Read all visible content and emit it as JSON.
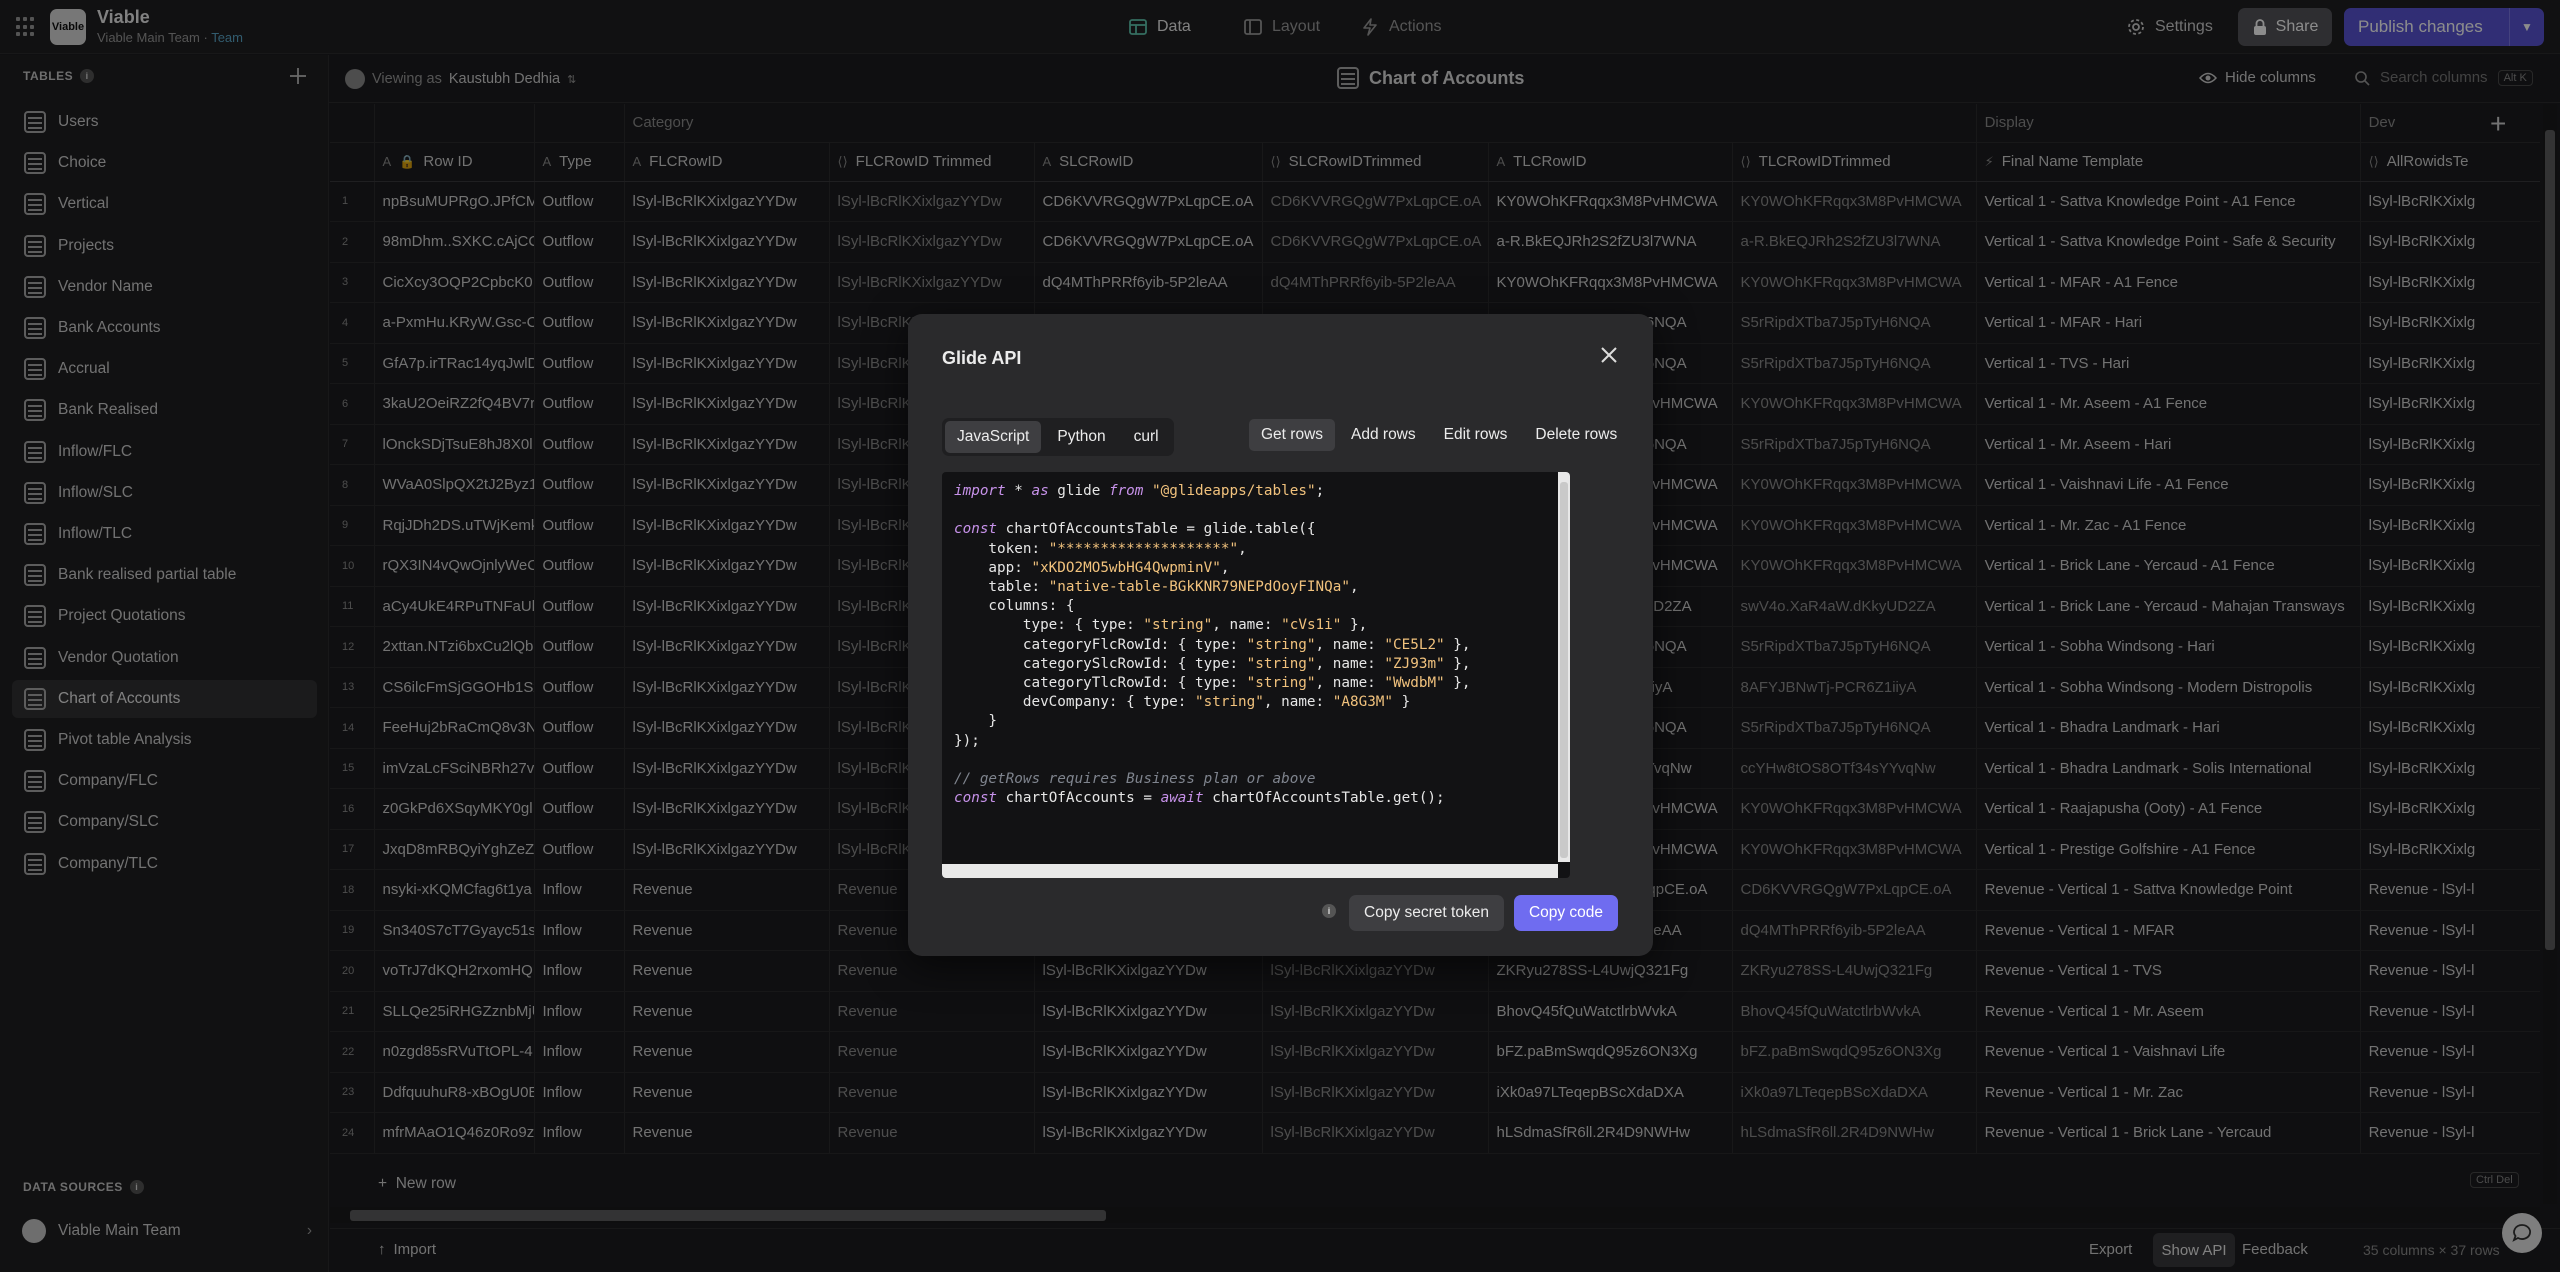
{
  "app": {
    "name": "Viable",
    "team_name": "Viable Main Team",
    "team_sep": " · ",
    "team_label": "Team",
    "logo_text": "Viable"
  },
  "nav": {
    "data": "Data",
    "layout": "Layout",
    "actions": "Actions"
  },
  "header": {
    "settings": "Settings",
    "share": "Share",
    "publish": "Publish changes"
  },
  "sidebar": {
    "tables_label": "TABLES",
    "items": [
      "Users",
      "Choice",
      "Vertical",
      "Projects",
      "Vendor Name",
      "Bank Accounts",
      "Accrual",
      "Bank Realised",
      "Inflow/FLC",
      "Inflow/SLC",
      "Inflow/TLC",
      "Bank realised partial table",
      "Project Quotations",
      "Vendor Quotation",
      "Chart of Accounts",
      "Pivot table Analysis",
      "Company/FLC",
      "Company/SLC",
      "Company/TLC"
    ],
    "active": "Chart of Accounts",
    "data_sources_label": "DATA SOURCES",
    "data_source": "Viable Main Team"
  },
  "subbar": {
    "viewing_prefix": "Viewing as",
    "viewing_user": "Kaustubh Dedhia",
    "table_title": "Chart of Accounts",
    "hide_columns": "Hide columns",
    "search_placeholder": "Search columns",
    "search_shortcut": "Alt K"
  },
  "grid": {
    "groups": {
      "category": "Category",
      "display": "Display",
      "dev": "Dev"
    },
    "headers": [
      "Row ID",
      "Type",
      "FLCRowID",
      "FLCRowID Trimmed",
      "SLCRowID",
      "SLCRowIDTrimmed",
      "TLCRowID",
      "TLCRowIDTrimmed",
      "Final Name Template",
      "AllRowidsTe"
    ],
    "rows": [
      [
        "npBsuMUPRgO.JPfCM",
        "Outflow",
        "lSyl-lBcRlKXixlgazYYDw",
        "lSyl-lBcRlKXixlgazYYDw",
        "CD6KVVRGQgW7PxLqpCE.oA",
        "CD6KVVRGQgW7PxLqpCE.oA",
        "KY0WOhKFRqqx3M8PvHMCWA",
        "KY0WOhKFRqqx3M8PvHMCWA",
        "Vertical 1 - Sattva Knowledge Point - A1 Fence",
        "lSyl-lBcRlKXixlg"
      ],
      [
        "98mDhm..SXKC.cAjCC",
        "Outflow",
        "lSyl-lBcRlKXixlgazYYDw",
        "lSyl-lBcRlKXixlgazYYDw",
        "CD6KVVRGQgW7PxLqpCE.oA",
        "CD6KVVRGQgW7PxLqpCE.oA",
        "a-R.BkEQJRh2S2fZU3l7WNA",
        "a-R.BkEQJRh2S2fZU3l7WNA",
        "Vertical 1 - Sattva Knowledge Point - Safe & Security",
        "lSyl-lBcRlKXixlg"
      ],
      [
        "CicXcy3OQP2CpbcK0",
        "Outflow",
        "lSyl-lBcRlKXixlgazYYDw",
        "lSyl-lBcRlKXixlgazYYDw",
        "dQ4MThPRRf6yib-5P2leAA",
        "dQ4MThPRRf6yib-5P2leAA",
        "KY0WOhKFRqqx3M8PvHMCWA",
        "KY0WOhKFRqqx3M8PvHMCWA",
        "Vertical 1 - MFAR - A1 Fence",
        "lSyl-lBcRlKXixlg"
      ],
      [
        "a-PxmHu.KRyW.Gsc-C",
        "Outflow",
        "lSyl-lBcRlKXixlgazYYDw",
        "lSyl-lBcRlKXixlgazYYDw",
        "",
        "",
        "S5rRipdXTba7J5pTyH6NQA",
        "S5rRipdXTba7J5pTyH6NQA",
        "Vertical 1 - MFAR - Hari",
        "lSyl-lBcRlKXixlg"
      ],
      [
        "GfA7p.irTRac14yqJwlD",
        "Outflow",
        "lSyl-lBcRlKXixlgazYYDw",
        "lSyl-lBcRlKXixlgazYYDw",
        "",
        "",
        "S5rRipdXTba7J5pTyH6NQA",
        "S5rRipdXTba7J5pTyH6NQA",
        "Vertical 1 - TVS - Hari",
        "lSyl-lBcRlKXixlg"
      ],
      [
        "3kaU2OeiRZ2fQ4BV7r",
        "Outflow",
        "lSyl-lBcRlKXixlgazYYDw",
        "lSyl-lBcRlKXixlgazYYDw",
        "",
        "",
        "KY0WOhKFRqqx3M8PvHMCWA",
        "KY0WOhKFRqqx3M8PvHMCWA",
        "Vertical 1 - Mr. Aseem - A1 Fence",
        "lSyl-lBcRlKXixlg"
      ],
      [
        "lOnckSDjTsuE8hJ8X0l",
        "Outflow",
        "lSyl-lBcRlKXixlgazYYDw",
        "lSyl-lBcRlKXixlgazYYDw",
        "",
        "",
        "S5rRipdXTba7J5pTyH6NQA",
        "S5rRipdXTba7J5pTyH6NQA",
        "Vertical 1 - Mr. Aseem - Hari",
        "lSyl-lBcRlKXixlg"
      ],
      [
        "WVaA0SlpQX2tJ2Byz1",
        "Outflow",
        "lSyl-lBcRlKXixlgazYYDw",
        "lSyl-lBcRlKXixlgazYYDw",
        "",
        "",
        "KY0WOhKFRqqx3M8PvHMCWA",
        "KY0WOhKFRqqx3M8PvHMCWA",
        "Vertical 1 - Vaishnavi Life - A1 Fence",
        "lSyl-lBcRlKXixlg"
      ],
      [
        "RqjJDh2DS.uTWjKemk",
        "Outflow",
        "lSyl-lBcRlKXixlgazYYDw",
        "lSyl-lBcRlKXixlgazYYDw",
        "",
        "",
        "KY0WOhKFRqqx3M8PvHMCWA",
        "KY0WOhKFRqqx3M8PvHMCWA",
        "Vertical 1 - Mr. Zac - A1 Fence",
        "lSyl-lBcRlKXixlg"
      ],
      [
        "rQX3IN4vQwOjnlyWeC",
        "Outflow",
        "lSyl-lBcRlKXixlgazYYDw",
        "lSyl-lBcRlKXixlgazYYDw",
        "",
        "",
        "KY0WOhKFRqqx3M8PvHMCWA",
        "KY0WOhKFRqqx3M8PvHMCWA",
        "Vertical 1 - Brick Lane - Yercaud - A1 Fence",
        "lSyl-lBcRlKXixlg"
      ],
      [
        "aCy4UkE4RPuTNFaUb",
        "Outflow",
        "lSyl-lBcRlKXixlgazYYDw",
        "lSyl-lBcRlKXixlgazYYDw",
        "",
        "",
        "swV4o.XaR4aW.dKkyUD2ZA",
        "swV4o.XaR4aW.dKkyUD2ZA",
        "Vertical 1 - Brick Lane - Yercaud - Mahajan Transways",
        "lSyl-lBcRlKXixlg"
      ],
      [
        "2xttan.NTzi6bxCu2lQb",
        "Outflow",
        "lSyl-lBcRlKXixlgazYYDw",
        "lSyl-lBcRlKXixlgazYYDw",
        "",
        "",
        "S5rRipdXTba7J5pTyH6NQA",
        "S5rRipdXTba7J5pTyH6NQA",
        "Vertical 1 - Sobha Windsong - Hari",
        "lSyl-lBcRlKXixlg"
      ],
      [
        "CS6ilcFmSjGGOHb1Sx1",
        "Outflow",
        "lSyl-lBcRlKXixlgazYYDw",
        "lSyl-lBcRlKXixlgazYYDw",
        "",
        "",
        "8AFYJBNwTj-PCR6Z1iiyA",
        "8AFYJBNwTj-PCR6Z1iiyA",
        "Vertical 1 - Sobha Windsong - Modern Distropolis",
        "lSyl-lBcRlKXixlg"
      ],
      [
        "FeeHuj2bRaCmQ8v3N",
        "Outflow",
        "lSyl-lBcRlKXixlgazYYDw",
        "lSyl-lBcRlKXixlgazYYDw",
        "",
        "",
        "S5rRipdXTba7J5pTyH6NQA",
        "S5rRipdXTba7J5pTyH6NQA",
        "Vertical 1 - Bhadra Landmark - Hari",
        "lSyl-lBcRlKXixlg"
      ],
      [
        "imVzaLcFSciNBRh27v",
        "Outflow",
        "lSyl-lBcRlKXixlgazYYDw",
        "lSyl-lBcRlKXixlgazYYDw",
        "",
        "",
        "ccYHw8tOS8OTf34sYYvqNw",
        "ccYHw8tOS8OTf34sYYvqNw",
        "Vertical 1 - Bhadra Landmark - Solis International",
        "lSyl-lBcRlKXixlg"
      ],
      [
        "z0GkPd6XSqyMKY0gl",
        "Outflow",
        "lSyl-lBcRlKXixlgazYYDw",
        "lSyl-lBcRlKXixlgazYYDw",
        "",
        "",
        "KY0WOhKFRqqx3M8PvHMCWA",
        "KY0WOhKFRqqx3M8PvHMCWA",
        "Vertical 1 - Raajapusha (Ooty) - A1 Fence",
        "lSyl-lBcRlKXixlg"
      ],
      [
        "JxqD8mRBQyiYghZeZ",
        "Outflow",
        "lSyl-lBcRlKXixlgazYYDw",
        "lSyl-lBcRlKXixlgazYYDw",
        "",
        "",
        "KY0WOhKFRqqx3M8PvHMCWA",
        "KY0WOhKFRqqx3M8PvHMCWA",
        "Vertical 1 - Prestige Golfshire - A1 Fence",
        "lSyl-lBcRlKXixlg"
      ],
      [
        "nsyki-xKQMCfag6t1ya",
        "Inflow",
        "Revenue",
        "Revenue",
        "",
        "",
        "CD6KVVRGQgW7PxLqpCE.oA",
        "CD6KVVRGQgW7PxLqpCE.oA",
        "Revenue - Vertical 1 - Sattva Knowledge Point",
        "Revenue - lSyl-l"
      ],
      [
        "Sn340S7cT7Gyayc51sl",
        "Inflow",
        "Revenue",
        "Revenue",
        "",
        "",
        "dQ4MThPRRf6yib-5P2leAA",
        "dQ4MThPRRf6yib-5P2leAA",
        "Revenue - Vertical 1 - MFAR",
        "Revenue - lSyl-l"
      ],
      [
        "voTrJ7dKQH2rxomHQE",
        "Inflow",
        "Revenue",
        "Revenue",
        "lSyl-lBcRlKXixlgazYYDw",
        "lSyl-lBcRlKXixlgazYYDw",
        "ZKRyu278SS-L4UwjQ321Fg",
        "ZKRyu278SS-L4UwjQ321Fg",
        "Revenue - Vertical 1 - TVS",
        "Revenue - lSyl-l"
      ],
      [
        "SLLQe25iRHGZznbMjU",
        "Inflow",
        "Revenue",
        "Revenue",
        "lSyl-lBcRlKXixlgazYYDw",
        "lSyl-lBcRlKXixlgazYYDw",
        "BhovQ45fQuWatctlrbWvkA",
        "BhovQ45fQuWatctlrbWvkA",
        "Revenue - Vertical 1 - Mr. Aseem",
        "Revenue - lSyl-l"
      ],
      [
        "n0zgd85sRVuTtOPL-4",
        "Inflow",
        "Revenue",
        "Revenue",
        "lSyl-lBcRlKXixlgazYYDw",
        "lSyl-lBcRlKXixlgazYYDw",
        "bFZ.paBmSwqdQ95z6ON3Xg",
        "bFZ.paBmSwqdQ95z6ON3Xg",
        "Revenue - Vertical 1 - Vaishnavi Life",
        "Revenue - lSyl-l"
      ],
      [
        "DdfquuhuR8-xBOgU0E",
        "Inflow",
        "Revenue",
        "Revenue",
        "lSyl-lBcRlKXixlgazYYDw",
        "lSyl-lBcRlKXixlgazYYDw",
        "iXk0a97LTeqepBScXdaDXA",
        "iXk0a97LTeqepBScXdaDXA",
        "Revenue - Vertical 1 - Mr. Zac",
        "Revenue - lSyl-l"
      ],
      [
        "mfrMAaO1Q46z0Ro9z",
        "Inflow",
        "Revenue",
        "Revenue",
        "lSyl-lBcRlKXixlgazYYDw",
        "lSyl-lBcRlKXixlgazYYDw",
        "hLSdmaSfR6ll.2R4D9NWHw",
        "hLSdmaSfR6ll.2R4D9NWHw",
        "Revenue - Vertical 1 - Brick Lane - Yercaud",
        "Revenue - lSyl-l"
      ]
    ],
    "new_row": "New row"
  },
  "bottom": {
    "import": "Import",
    "export": "Export",
    "show_api": "Show API",
    "feedback": "Feedback",
    "count": "35 columns × 37 rows",
    "ctrl_shortcut": "Ctrl Del"
  },
  "modal": {
    "title": "Glide API",
    "lang_tabs": [
      "JavaScript",
      "Python",
      "curl"
    ],
    "action_tabs": [
      "Get rows",
      "Add rows",
      "Edit rows",
      "Delete rows"
    ],
    "copy_secret": "Copy secret token",
    "copy_code": "Copy code",
    "code": {
      "kw_import": "import",
      "l1_a": " * ",
      "kw_as": "as",
      "l1_b": " glide ",
      "kw_from": "from",
      "l1_c": " ",
      "str_pkg": "\"@glideapps/tables\"",
      "l1_d": ";",
      "kw_const1": "const",
      "l3": " chartOfAccountsTable = glide.table({",
      "l4_a": "    token: ",
      "str_token": "\"********************\"",
      "l4_b": ",",
      "l5_a": "    app: ",
      "str_app": "\"xKDO2MO5wbHG4QwpminV\"",
      "l5_b": ",",
      "l6_a": "    table: ",
      "str_table": "\"native-table-BGkKNR79NEPdOoyFINQa\"",
      "l6_b": ",",
      "l7": "    columns: {",
      "l8_a": "        type: { type: ",
      "str_t1": "\"string\"",
      "l8_b": ", name: ",
      "str_n1": "\"cVs1i\"",
      "l8_c": " },",
      "l9_a": "        categoryFlcRowId: { type: ",
      "str_t2": "\"string\"",
      "l9_b": ", name: ",
      "str_n2": "\"CE5L2\"",
      "l9_c": " },",
      "l10_a": "        categorySlcRowId: { type: ",
      "str_t3": "\"string\"",
      "l10_b": ", name: ",
      "str_n3": "\"ZJ93m\"",
      "l10_c": " },",
      "l11_a": "        categoryTlcRowId: { type: ",
      "str_t4": "\"string\"",
      "l11_b": ", name: ",
      "str_n4": "\"WwdbM\"",
      "l11_c": " },",
      "l12_a": "        devCompany: { type: ",
      "str_t5": "\"string\"",
      "l12_b": ", name: ",
      "str_n5": "\"A8G3M\"",
      "l12_c": " }",
      "l13": "    }",
      "l14": "});",
      "comment": "// getRows requires Business plan or above",
      "kw_const2": "const",
      "l17_a": " chartOfAccounts = ",
      "kw_await": "await",
      "l17_b": " chartOfAccountsTable.get();"
    }
  },
  "colors": {
    "accent": "#5a55d6",
    "copy_code": "#6f6cf0",
    "team_link": "#5aa6c8"
  }
}
